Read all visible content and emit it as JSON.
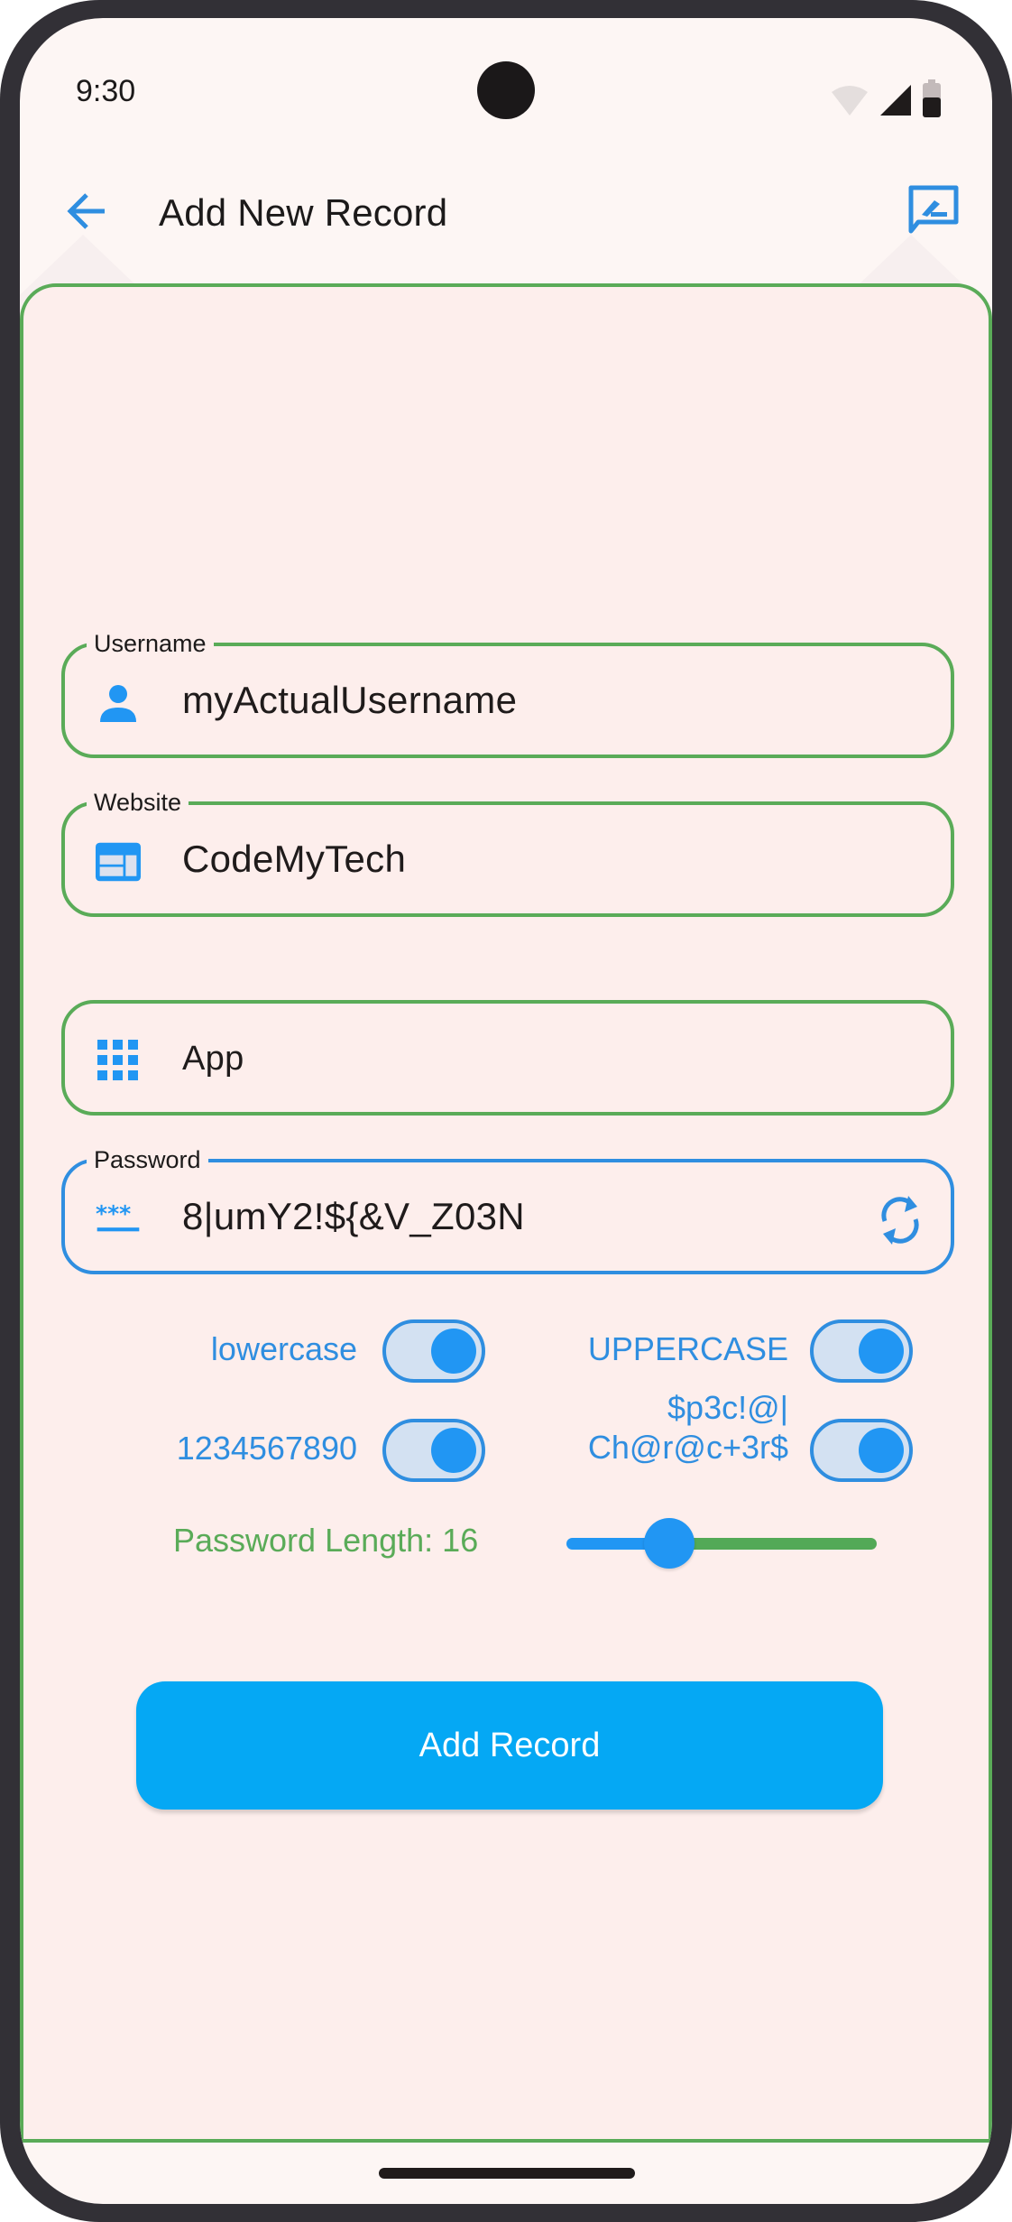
{
  "status_bar": {
    "time": "9:30",
    "icons": [
      "wifi-icon",
      "cellular-signal-icon",
      "battery-icon"
    ]
  },
  "app_bar": {
    "title": "Add New Record",
    "back_icon": "arrow-back-icon",
    "action_icon": "rate-review-icon"
  },
  "form": {
    "username": {
      "label": "Username",
      "value": "myActualUsername",
      "icon": "person-icon"
    },
    "website": {
      "label": "Website",
      "value": "CodeMyTech",
      "icon": "web-icon"
    },
    "app": {
      "label": "",
      "value": "App",
      "icon": "apps-grid-icon"
    },
    "password": {
      "label": "Password",
      "value": "8|umY2!${&V_Z03N",
      "icon": "password-icon",
      "action_icon": "refresh-icon"
    },
    "toggles": [
      {
        "label": "lowercase",
        "on": true
      },
      {
        "label": "UPPERCASE",
        "on": true
      },
      {
        "label": "1234567890",
        "on": true
      },
      {
        "label_line1": "$p3c!@|",
        "label_line2": "Ch@r@c+3r$",
        "on": true
      }
    ],
    "length": {
      "label": "Password Length: 16",
      "value": 16,
      "fraction": 0.33
    },
    "submit_label": "Add Record"
  },
  "colors": {
    "green": "#5aab58",
    "blue": "#2f8ee0",
    "button": "#05a8f4",
    "background": "#fdeeec"
  }
}
